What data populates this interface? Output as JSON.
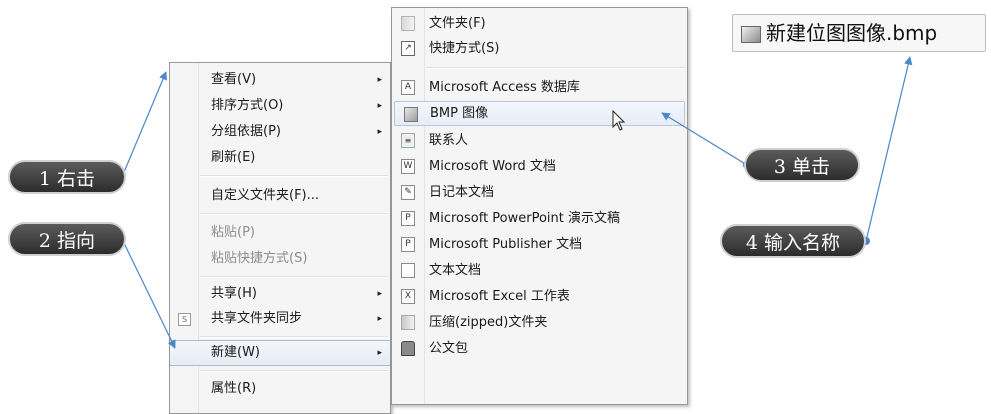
{
  "context_menu": {
    "items": [
      {
        "label": "查看(V)",
        "arrow": "▸"
      },
      {
        "label": "排序方式(O)",
        "arrow": "▸"
      },
      {
        "label": "分组依据(P)",
        "arrow": "▸"
      },
      {
        "label": "刷新(E)"
      },
      {
        "label": "自定义文件夹(F)..."
      },
      {
        "label": "粘贴(P)"
      },
      {
        "label": "粘贴快捷方式(S)"
      },
      {
        "label": "共享(H)",
        "arrow": "▸"
      },
      {
        "label": "共享文件夹同步",
        "arrow": "▸",
        "lead_icon": "S"
      },
      {
        "label": "新建(W)",
        "arrow": "▸"
      },
      {
        "label": "属性(R)"
      }
    ]
  },
  "new_submenu": {
    "items": [
      {
        "label": "文件夹(F)",
        "icon": "folder-icon"
      },
      {
        "label": "快捷方式(S)",
        "icon": "shortcut-icon",
        "glyph": "↗"
      },
      {
        "label": "Microsoft Access 数据库",
        "icon": "access-icon",
        "glyph": "A"
      },
      {
        "label": "BMP 图像",
        "icon": "bmp-image-icon"
      },
      {
        "label": "联系人",
        "icon": "contact-icon",
        "glyph": "≡"
      },
      {
        "label": "Microsoft Word 文档",
        "icon": "word-icon",
        "glyph": "W"
      },
      {
        "label": "日记本文档",
        "icon": "journal-icon",
        "glyph": "✎"
      },
      {
        "label": "Microsoft PowerPoint 演示文稿",
        "icon": "powerpoint-icon",
        "glyph": "P"
      },
      {
        "label": "Microsoft Publisher 文档",
        "icon": "publisher-icon",
        "glyph": "P"
      },
      {
        "label": "文本文档",
        "icon": "text-document-icon"
      },
      {
        "label": "Microsoft Excel 工作表",
        "icon": "excel-icon",
        "glyph": "X"
      },
      {
        "label": "压缩(zipped)文件夹",
        "icon": "zip-folder-icon"
      },
      {
        "label": "公文包",
        "icon": "briefcase-icon"
      }
    ]
  },
  "renamed_file": {
    "name": "新建位图图像.bmp"
  },
  "callouts": {
    "step1": "1 右击",
    "step2": "2 指向",
    "step3": "3 单击",
    "step4": "4 输入名称"
  },
  "colors": {
    "arrow": "#4a86c8",
    "callout_bg": "#3c3c3c",
    "highlight": "#e6edf6"
  }
}
